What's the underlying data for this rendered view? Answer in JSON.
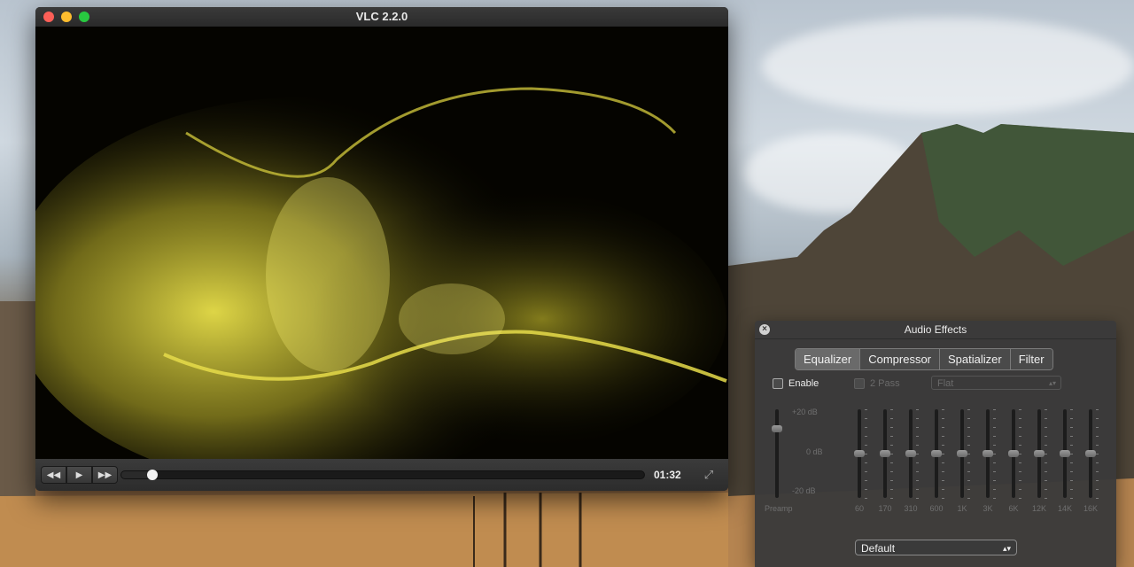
{
  "window": {
    "title": "VLC 2.2.0"
  },
  "player": {
    "time": "01:32",
    "progress": 0.06,
    "buttons": {
      "rewind": "◀◀",
      "play": "▶",
      "forward": "▶▶",
      "fullscreen": "⤢"
    }
  },
  "audio_effects": {
    "title": "Audio Effects",
    "close": "×",
    "tabs": [
      "Equalizer",
      "Compressor",
      "Spatializer",
      "Filter"
    ],
    "active_tab": "Equalizer",
    "enable_label": "Enable",
    "two_pass_label": "2 Pass",
    "preset_disabled_value": "Flat",
    "db_labels": {
      "top": "+20 dB",
      "mid": "0 dB",
      "bottom": "-20 dB"
    },
    "preamp_label": "Preamp",
    "preamp_level": 0.22,
    "bands": [
      {
        "label": "60",
        "level": 0.5
      },
      {
        "label": "170",
        "level": 0.5
      },
      {
        "label": "310",
        "level": 0.5
      },
      {
        "label": "600",
        "level": 0.5
      },
      {
        "label": "1K",
        "level": 0.5
      },
      {
        "label": "3K",
        "level": 0.5
      },
      {
        "label": "6K",
        "level": 0.5
      },
      {
        "label": "12K",
        "level": 0.5
      },
      {
        "label": "14K",
        "level": 0.5
      },
      {
        "label": "16K",
        "level": 0.5
      }
    ],
    "preset_value": "Default",
    "preset_arrows": "▴▾"
  },
  "colors": {
    "accent_yellow": "#d8cf2a",
    "panel": "#3a3a3a"
  }
}
